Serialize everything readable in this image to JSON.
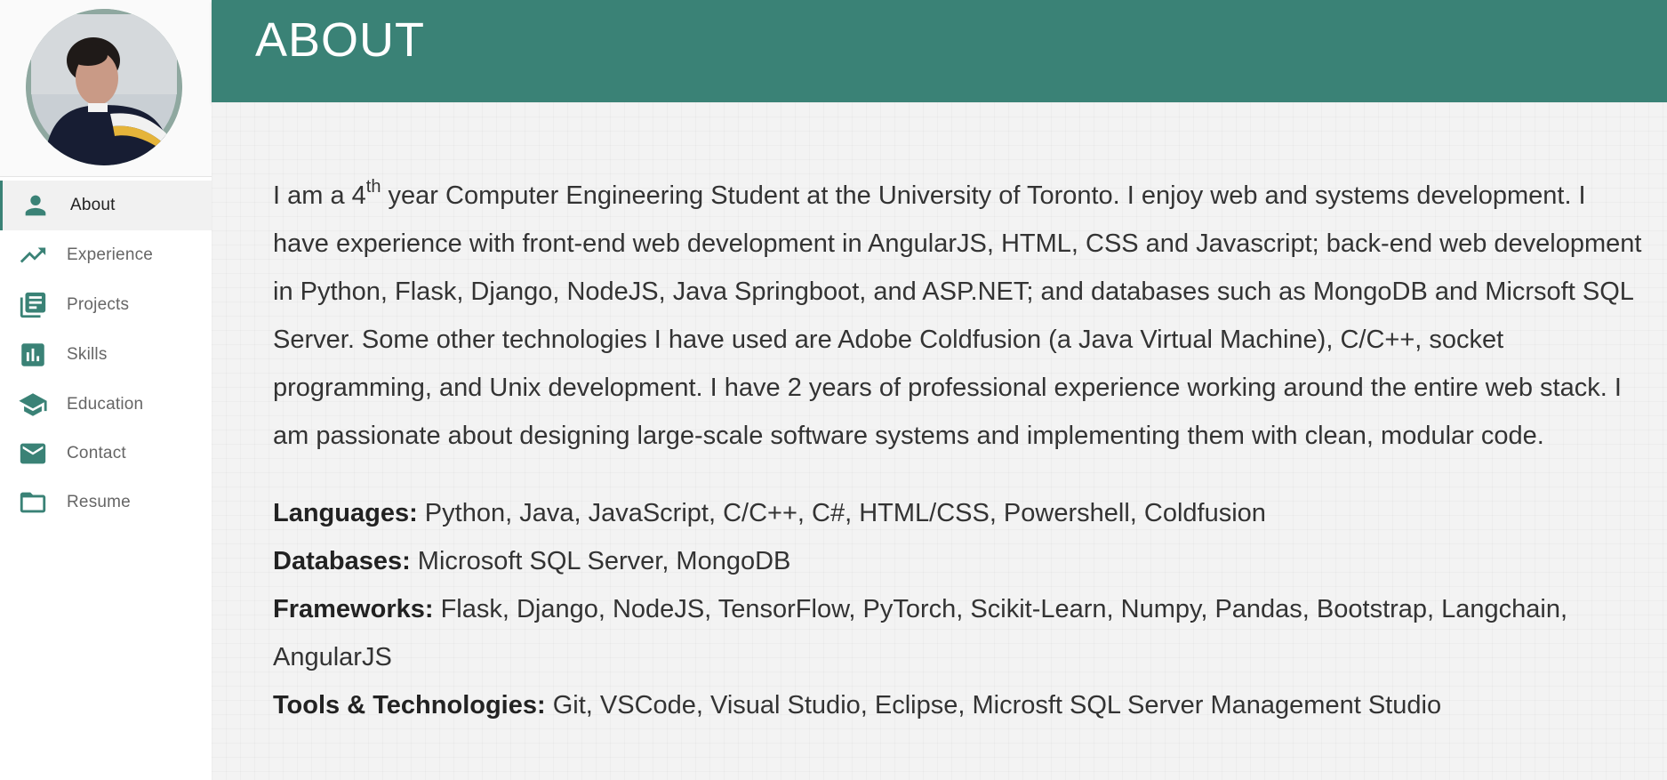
{
  "theme": {
    "accent": "#3a8276",
    "background": "#f3f3f3"
  },
  "sidebar": {
    "avatar_alt": "profile photo",
    "items": [
      {
        "label": "About",
        "icon": "person-icon",
        "active": true
      },
      {
        "label": "Experience",
        "icon": "trending-up-icon",
        "active": false
      },
      {
        "label": "Projects",
        "icon": "library-books-icon",
        "active": false
      },
      {
        "label": "Skills",
        "icon": "bar-chart-icon",
        "active": false
      },
      {
        "label": "Education",
        "icon": "school-icon",
        "active": false
      },
      {
        "label": "Contact",
        "icon": "mail-icon",
        "active": false
      },
      {
        "label": "Resume",
        "icon": "folder-icon",
        "active": false
      }
    ]
  },
  "header": {
    "title": "ABOUT"
  },
  "about": {
    "intro_before": "I am a 4",
    "intro_sup": "th",
    "intro_after": " year Computer Engineering Student at the University of Toronto. I enjoy web and systems development. I have experience with front-end web development in AngularJS, HTML, CSS and Javascript; back-end web development in Python, Flask, Django, NodeJS, Java Springboot, and ASP.NET; and databases such as MongoDB and Micrsoft SQL Server. Some other technologies I have used are Adobe Coldfusion (a Java Virtual Machine), C/C++, socket programming, and Unix development. I have 2 years of professional experience working around the entire web stack. I am passionate about designing large-scale software systems and implementing them with clean, modular code.",
    "skills": [
      {
        "label": "Languages:",
        "value": " Python, Java, JavaScript, C/C++, C#, HTML/CSS, Powershell, Coldfusion"
      },
      {
        "label": "Databases:",
        "value": " Microsoft SQL Server, MongoDB"
      },
      {
        "label": "Frameworks:",
        "value": " Flask, Django, NodeJS, TensorFlow, PyTorch, Scikit-Learn, Numpy, Pandas, Bootstrap, Langchain, AngularJS"
      },
      {
        "label": "Tools & Technologies:",
        "value": " Git, VSCode, Visual Studio, Eclipse, Microsft SQL Server Management Studio"
      }
    ]
  }
}
